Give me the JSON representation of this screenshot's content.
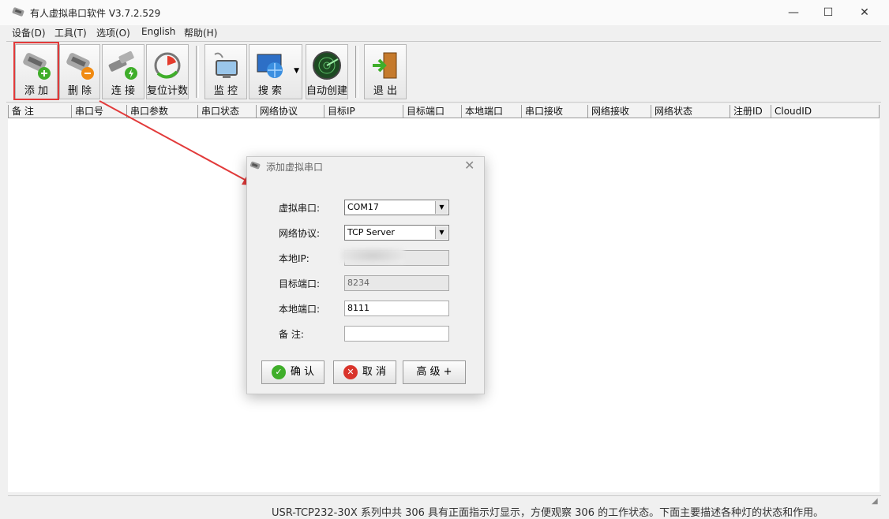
{
  "window": {
    "title": "有人虚拟串口软件 V3.7.2.529",
    "minimize": "—",
    "maximize": "☐",
    "close": "✕"
  },
  "menu": [
    "设备(D)",
    "工具(T)",
    "选项(O)",
    "English",
    "帮助(H)"
  ],
  "toolbar": {
    "add": "添 加",
    "delete": "删 除",
    "connect": "连 接",
    "reset": "复位计数",
    "monitor": "监 控",
    "search": "搜 索",
    "auto_create": "自动创建",
    "exit": "退 出"
  },
  "columns": [
    "备 注",
    "串口号",
    "串口参数",
    "串口状态",
    "网络协议",
    "目标IP",
    "目标端口",
    "本地端口",
    "串口接收",
    "网络接收",
    "网络状态",
    "注册ID",
    "CloudID"
  ],
  "dialog": {
    "title": "添加虚拟串口",
    "close": "✕",
    "labels": {
      "serial": "虚拟串口:",
      "protocol": "网络协议:",
      "local_ip": "本地IP:",
      "target_port": "目标端口:",
      "local_port": "本地端口:",
      "note": "备  注:"
    },
    "values": {
      "serial": "COM17",
      "protocol": "TCP Server",
      "local_ip": "",
      "target_port": "8234",
      "local_port": "8111",
      "note": ""
    },
    "buttons": {
      "ok": "确 认",
      "cancel": "取 消",
      "advanced": "高 级 +"
    }
  },
  "background_text": "USR-TCP232-30X 系列中共 306 具有正面指示灯显示，方便观察 306 的工作状态。下面主要描述各种灯的状态和作用。"
}
